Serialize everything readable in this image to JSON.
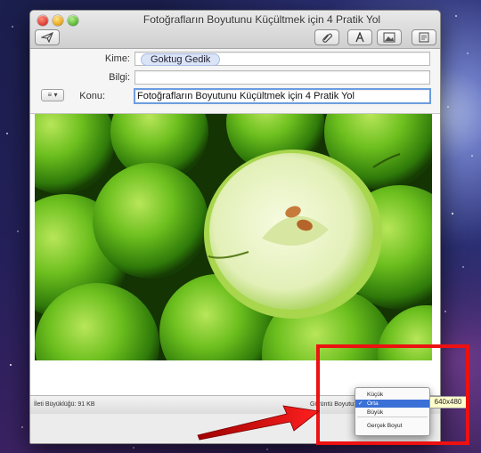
{
  "window": {
    "title": "Fotoğrafların Boyutunu Küçültmek için 4 Pratik Yol"
  },
  "toolbar": {
    "send_icon": "paper-plane-icon",
    "attach_icon": "paperclip-icon",
    "format_icon": "font-icon",
    "photo_browser_icon": "photo-icon",
    "stationery_icon": "stationery-icon"
  },
  "header": {
    "to_label": "Kime:",
    "to_value": "Goktug Gedik",
    "cc_label": "Bilgi:",
    "cc_value": "",
    "subject_label": "Konu:",
    "subject_value": "Fotoğrafların Boyutunu Küçültmek için 4 Pratik Yol",
    "list_button": "≡ ▾"
  },
  "status": {
    "message_size": "İleti Büyüklüğü:  91 KB",
    "image_size_label": "Görüntü Boyutu:"
  },
  "image_size_menu": {
    "items": [
      "Küçük",
      "Orta",
      "Büyük",
      "Gerçek Boyut"
    ],
    "selected": "Orta",
    "checkmark": "✓"
  },
  "dimensions_badge": "640x480",
  "colors": {
    "highlight": "#e11111",
    "menu_selection": "#3b70d6",
    "subject_focus": "#6c9ce0"
  }
}
